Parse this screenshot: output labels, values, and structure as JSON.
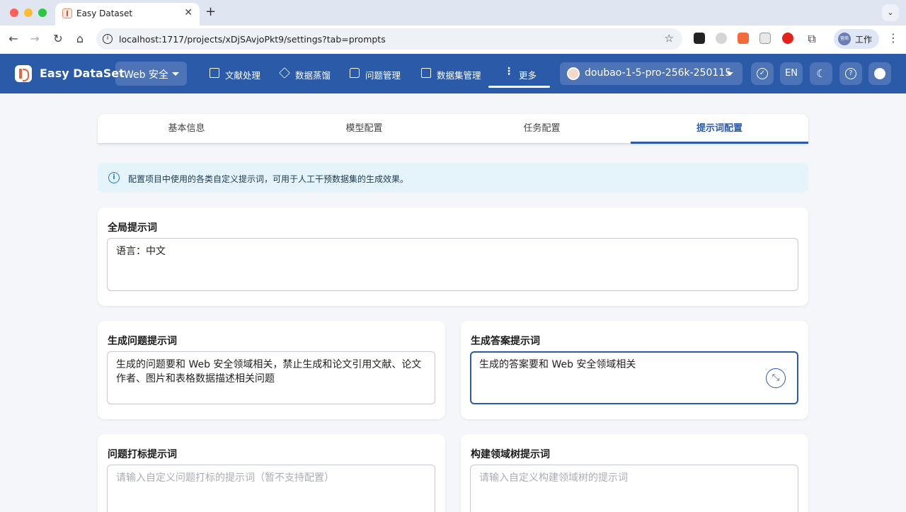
{
  "browser": {
    "tab_title": "Easy Dataset",
    "url": "localhost:1717/projects/xDjSAvjoPkt9/settings?tab=prompts",
    "profile_label": "工作",
    "profile_avatar_text": "营商"
  },
  "app": {
    "name": "Easy DataSet",
    "project": "Web 安全",
    "nav": [
      {
        "label": "文献处理",
        "icon": "document-icon"
      },
      {
        "label": "数据蒸馏",
        "icon": "cube-icon"
      },
      {
        "label": "问题管理",
        "icon": "chat-icon"
      },
      {
        "label": "数据集管理",
        "icon": "grid-icon"
      },
      {
        "label": "更多",
        "icon": "more-vertical-icon"
      }
    ],
    "model": "doubao-1-5-pro-256k-250115",
    "lang_button": "EN"
  },
  "settings": {
    "tabs": [
      "基本信息",
      "模型配置",
      "任务配置",
      "提示词配置"
    ],
    "active_tab": "提示词配置",
    "alert": "配置项目中使用的各类自定义提示词，可用于人工干预数据集的生成效果。"
  },
  "prompts": {
    "global": {
      "title": "全局提示词",
      "value": "语言：中文"
    },
    "question": {
      "title": "生成问题提示词",
      "value": "生成的问题要和 Web 安全领域相关，禁止生成和论文引用文献、论文作者、图片和表格数据描述相关问题"
    },
    "answer": {
      "title": "生成答案提示词",
      "value": "生成的答案要和 Web 安全领域相关"
    },
    "labeling": {
      "title": "问题打标提示词",
      "placeholder": "请输入自定义问题打标的提示词（暂不支持配置）"
    },
    "domain_tree": {
      "title": "构建领域树提示词",
      "placeholder": "请输入自定义构建领域树的提示词"
    }
  },
  "colors": {
    "primary": "#2b5aa8",
    "alert_bg": "#e5f4fb",
    "page_bg": "#f4f6fa"
  }
}
